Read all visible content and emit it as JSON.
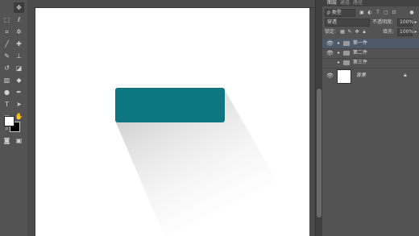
{
  "panel": {
    "tabs": [
      "图层",
      "通道",
      "路径"
    ],
    "filter_label": "ρ 类型",
    "blend_mode": "穿透",
    "opacity_label": "不透明度:",
    "opacity_value": "100%",
    "lock_label": "锁定:",
    "fill_label": "填充:",
    "fill_value": "100%",
    "layers": [
      {
        "name": "第一件",
        "visible": true,
        "selected": true
      },
      {
        "name": "第二件",
        "visible": true,
        "selected": false
      },
      {
        "name": "第三件",
        "visible": false,
        "selected": false
      }
    ],
    "background_layer": "背景"
  },
  "canvas": {
    "rect_color": "#0e7680",
    "background": "#ffffff"
  },
  "toolbar": {
    "tools": [
      "move-tool",
      "marquee-tool",
      "lasso-tool",
      "magic-wand-tool",
      "crop-tool",
      "eyedropper-tool",
      "healing-brush-tool",
      "brush-tool",
      "clone-stamp-tool",
      "history-brush-tool",
      "eraser-tool",
      "gradient-tool",
      "blur-tool",
      "dodge-tool",
      "pen-tool",
      "type-tool",
      "path-selection-tool",
      "shape-tool",
      "hand-tool",
      "zoom-tool"
    ]
  }
}
